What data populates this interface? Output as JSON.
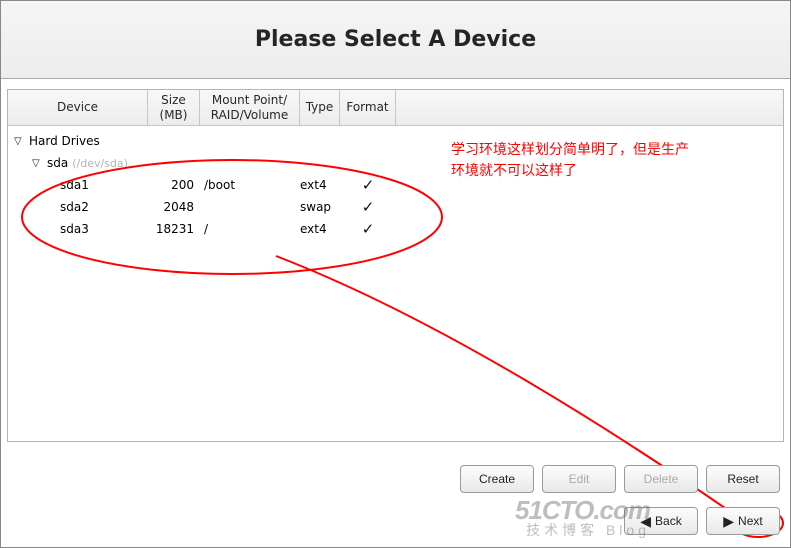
{
  "title": "Please Select A Device",
  "headers": {
    "device": "Device",
    "size": "Size (MB)",
    "mount": "Mount Point/ RAID/Volume",
    "type": "Type",
    "format": "Format"
  },
  "tree": {
    "root_label": "Hard Drives",
    "disk_label": "sda",
    "disk_sub": "(/dev/sda)",
    "partitions": [
      {
        "name": "sda1",
        "size": "200",
        "mount": "/boot",
        "type": "ext4",
        "format": true
      },
      {
        "name": "sda2",
        "size": "2048",
        "mount": "",
        "type": "swap",
        "format": true
      },
      {
        "name": "sda3",
        "size": "18231",
        "mount": "/",
        "type": "ext4",
        "format": true
      }
    ]
  },
  "annotation": {
    "line1": "学习环境这样划分简单明了，但是生产",
    "line2": "环境就不可以这样了"
  },
  "buttons": {
    "create": "Create",
    "edit": "Edit",
    "delete": "Delete",
    "reset": "Reset",
    "back": "Back",
    "next": "Next"
  },
  "watermark": {
    "line1": "51CTO.com",
    "line2": "技术博客   Blog"
  }
}
